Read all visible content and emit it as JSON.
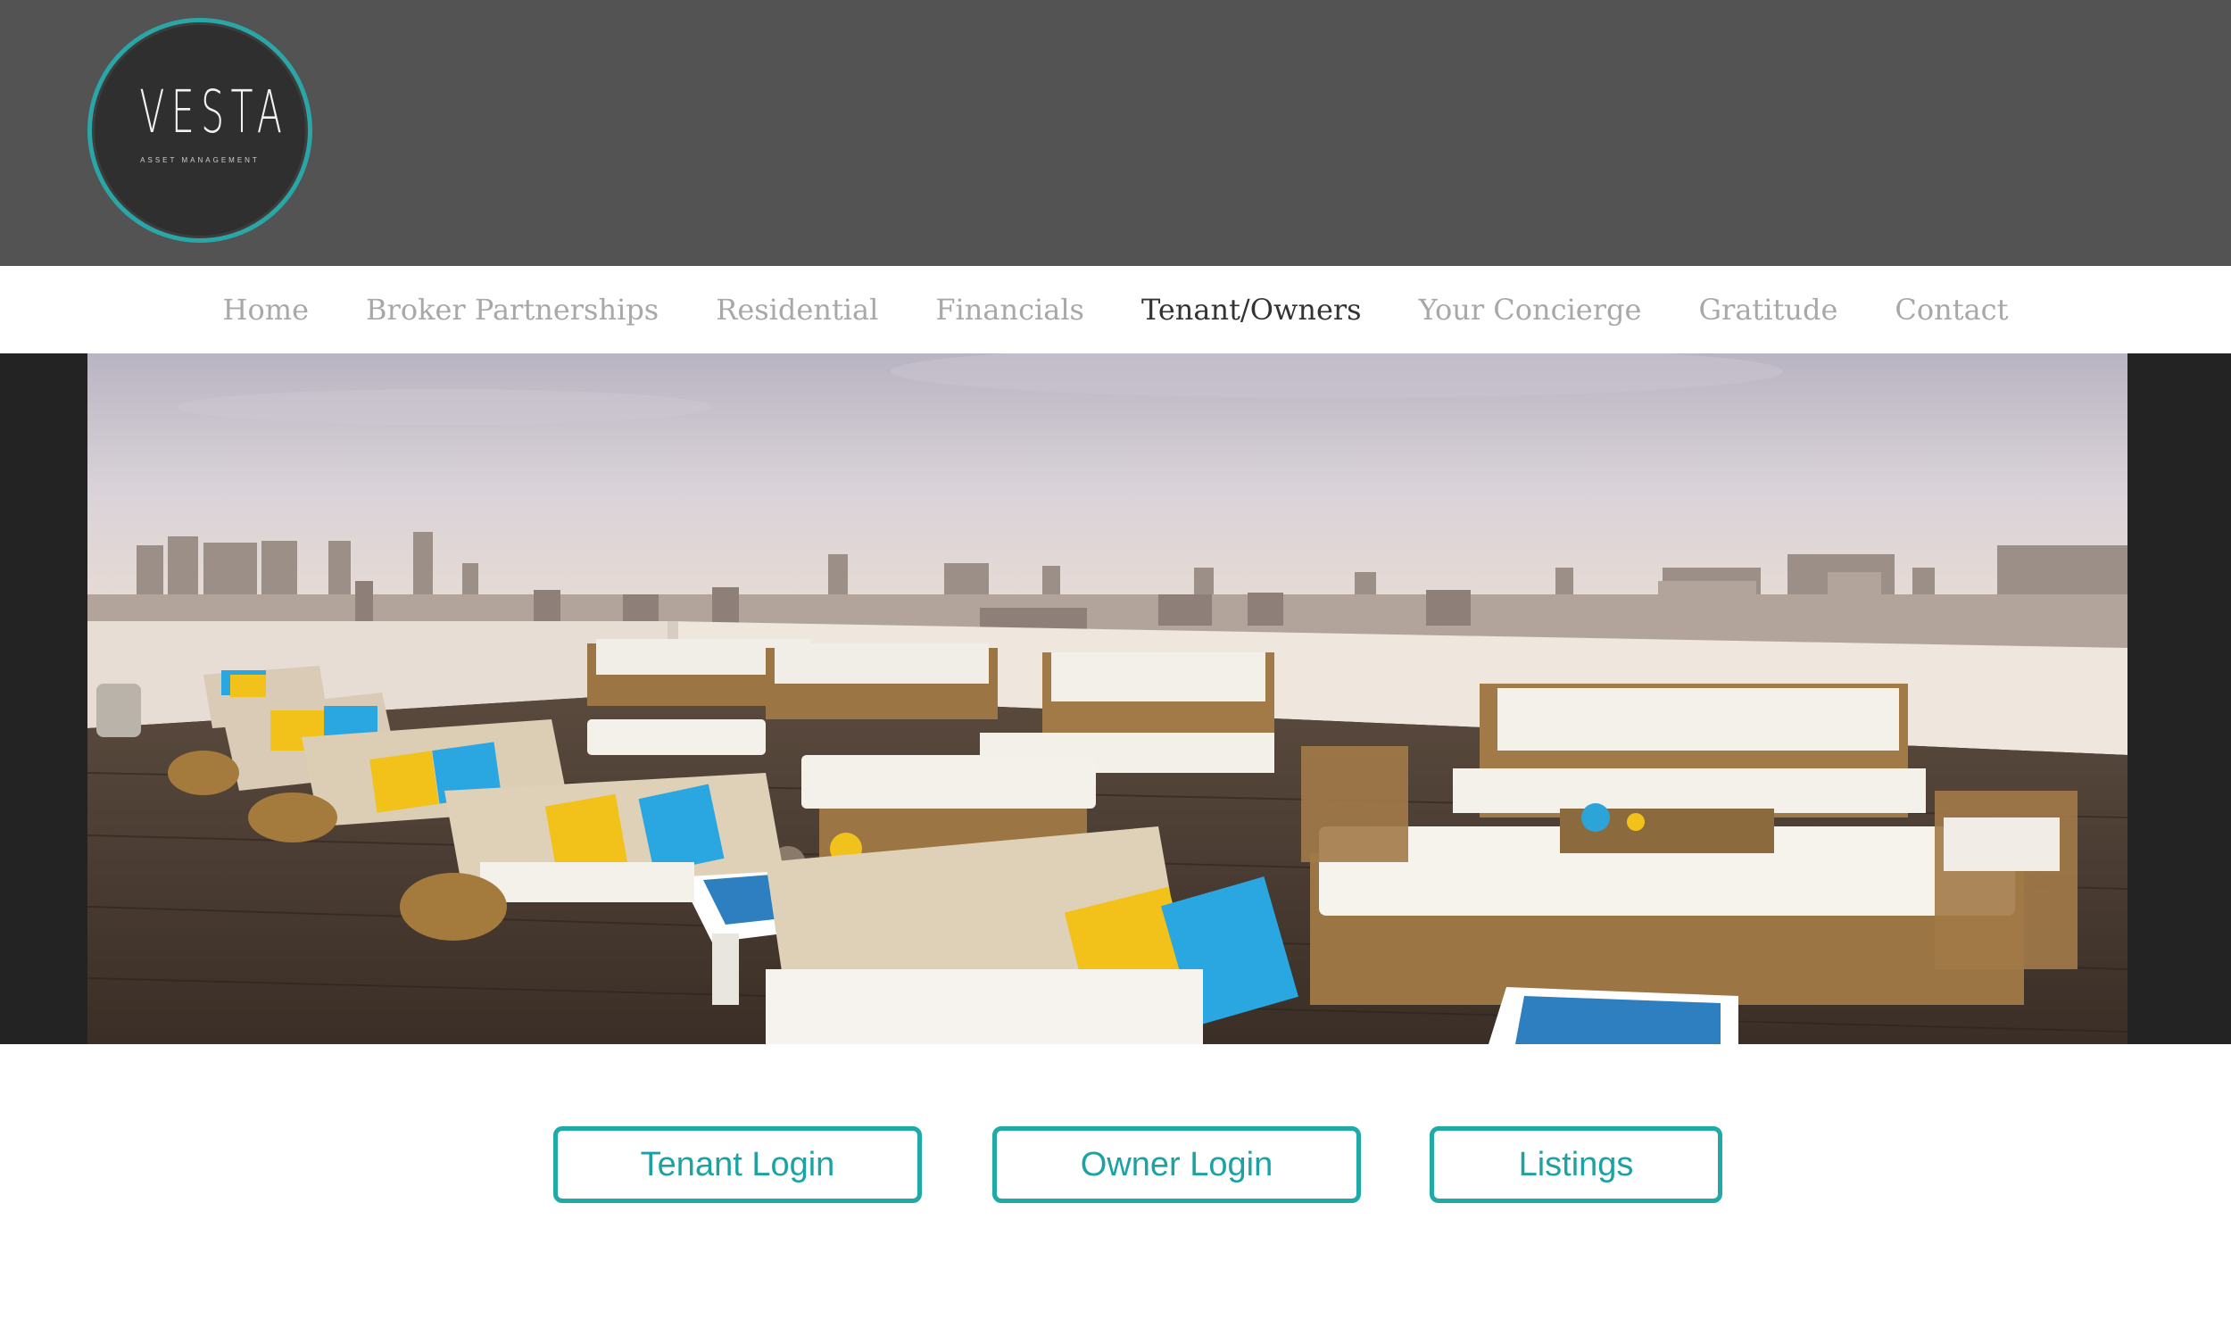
{
  "brand": {
    "logo_word": "VESTA",
    "logo_sub": "ASSET MANAGEMENT",
    "accent_color": "#2aa6a6"
  },
  "nav": {
    "items": [
      {
        "label": "Home"
      },
      {
        "label": "Broker Partnerships"
      },
      {
        "label": "Residential"
      },
      {
        "label": "Financials"
      },
      {
        "label": "Tenant/Owners",
        "active": true
      },
      {
        "label": "Your Concierge"
      },
      {
        "label": "Gratitude"
      },
      {
        "label": "Contact"
      }
    ]
  },
  "hero": {
    "image": "rooftop-lounge-city-skyline"
  },
  "actions": {
    "tenant_login": "Tenant Login",
    "owner_login": "Owner Login",
    "listings": "Listings"
  }
}
